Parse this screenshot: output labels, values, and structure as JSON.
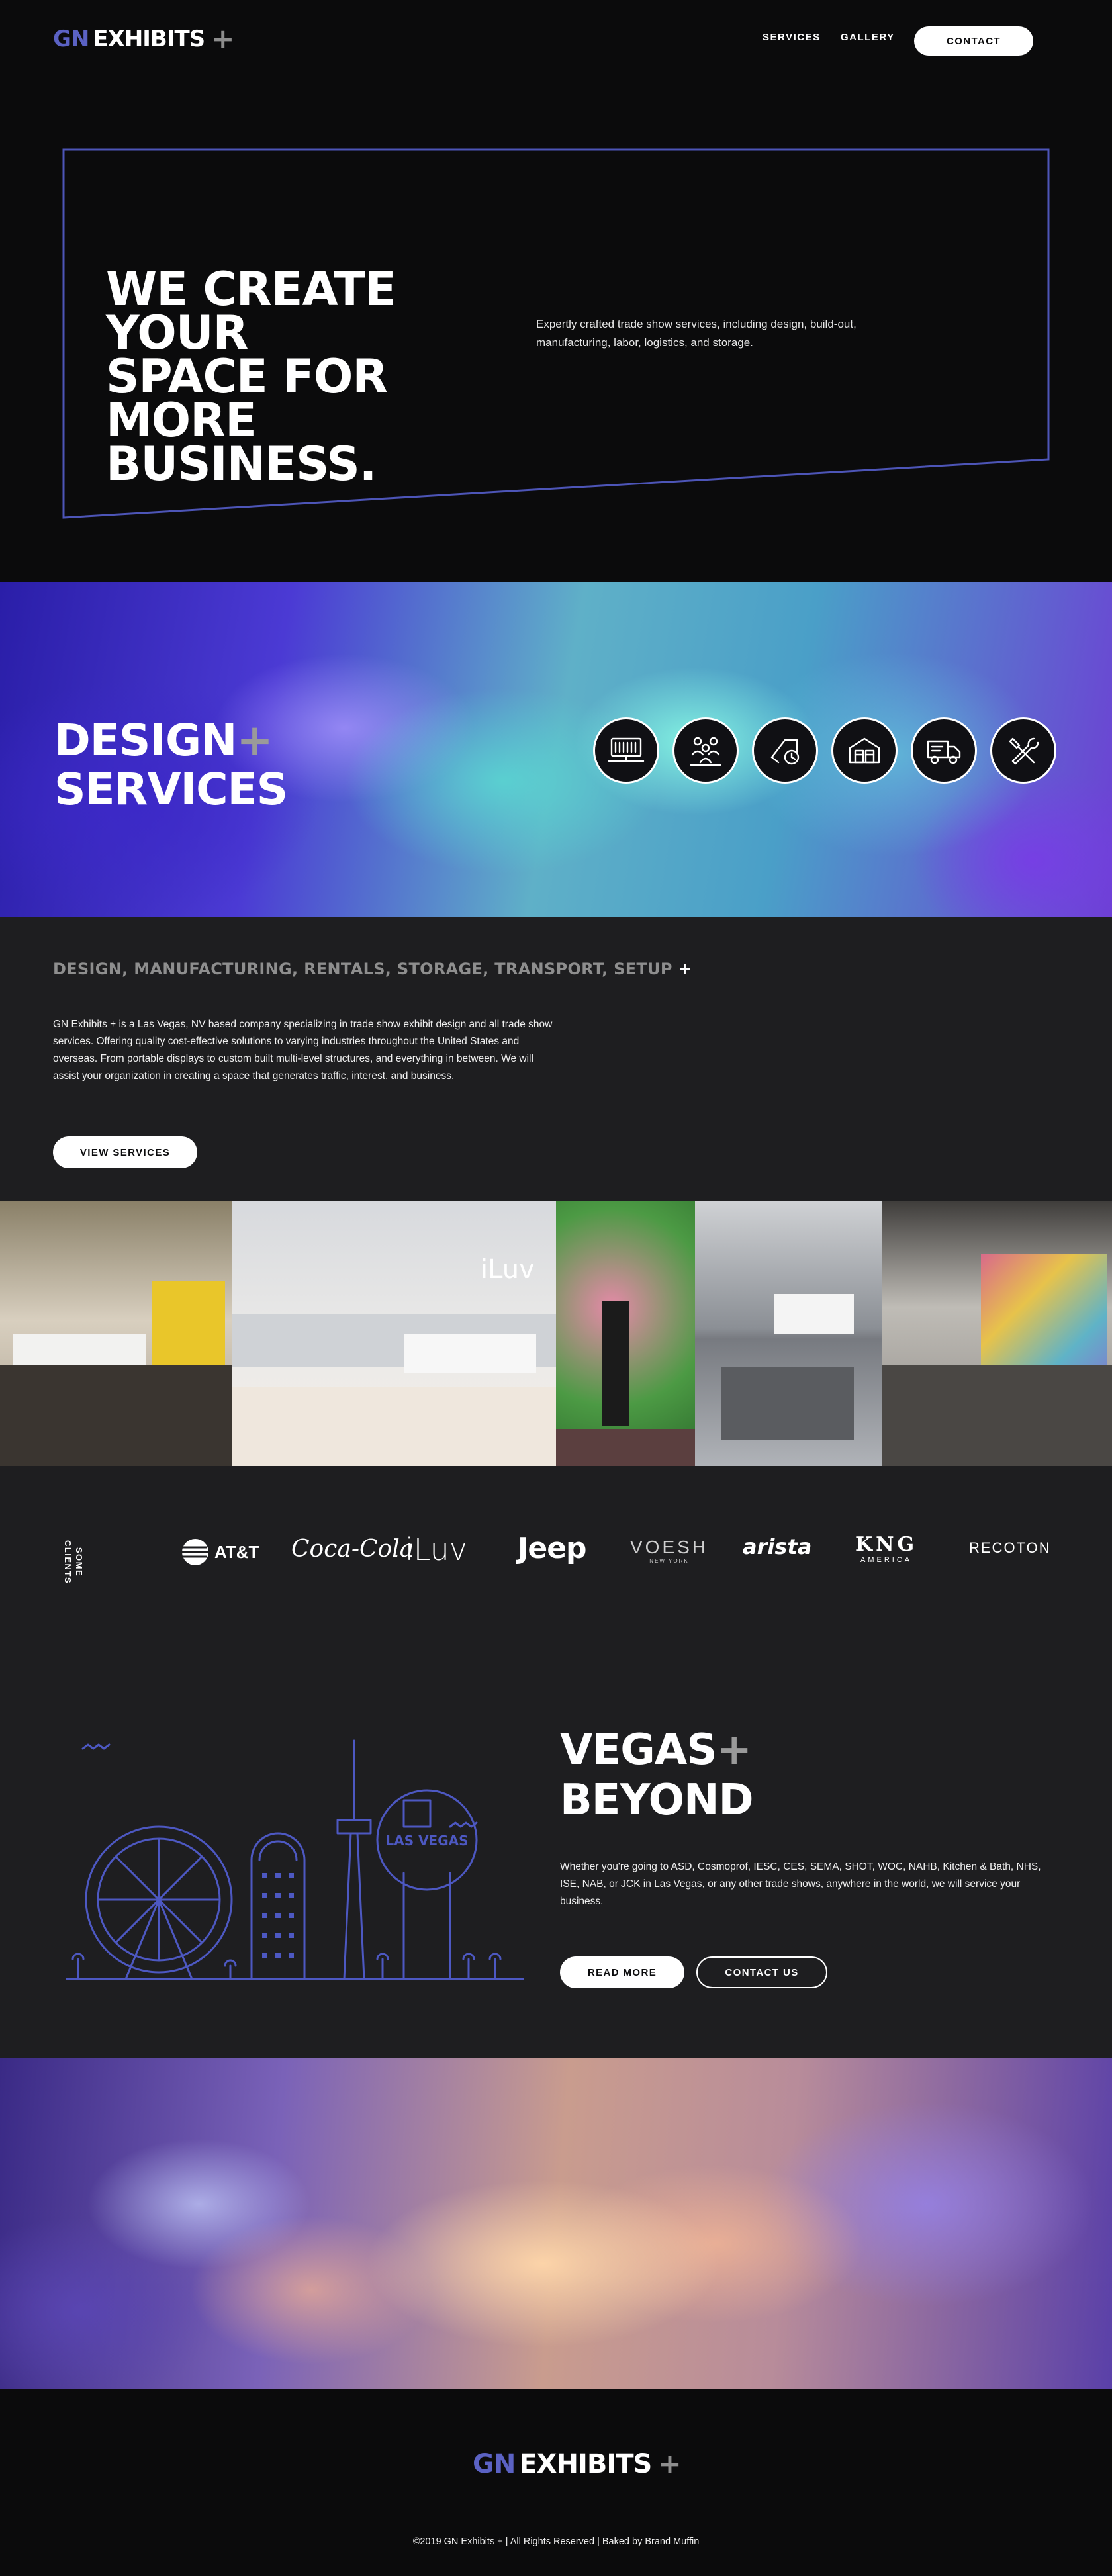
{
  "nav": {
    "logo": {
      "gn": "GN",
      "exhibits": "EXHIBITS",
      "plus": "+"
    },
    "links": [
      "SERVICES",
      "GALLERY"
    ],
    "contact_label": "CONTACT"
  },
  "hero": {
    "title_lines": [
      "WE CREATE YOUR",
      "SPACE FOR MORE",
      "BUSINESS."
    ],
    "subtitle": "Expertly crafted trade show services, including design, build-out, manufacturing, labor, logistics, and storage."
  },
  "design": {
    "title_line1": "DESIGN",
    "title_plus": "+",
    "title_line2": "SERVICES",
    "icons": [
      "display-booth-icon",
      "team-labor-icon",
      "design-clock-icon",
      "warehouse-storage-icon",
      "delivery-truck-icon",
      "tools-setup-icon"
    ]
  },
  "services": {
    "heading": "DESIGN, MANUFACTURING, RENTALS, STORAGE, TRANSPORT, SETUP",
    "heading_plus": "+",
    "body": "GN Exhibits + is a Las Vegas, NV based company specializing in trade show exhibit design and all trade show services. Offering quality cost-effective solutions to varying industries throughout the United States and overseas. From portable displays to custom built multi-level structures, and everything in between. We will assist your organization in creating a space that generates traffic, interest, and business.",
    "button_label": "VIEW SERVICES"
  },
  "gallery": {
    "photo_overlay_text": "iLuv"
  },
  "clients": {
    "label_line1": "SOME",
    "label_line2": "CLIENTS",
    "logos": [
      "AT&T",
      "Coca-Cola",
      "iLuv",
      "Jeep",
      "VOESH",
      "NEW YORK",
      "arista",
      "KNG",
      "AMERICA",
      "RECOTON"
    ]
  },
  "vegas": {
    "title_line1": "VEGAS",
    "title_plus": "+",
    "title_line2": "BEYOND",
    "illustration_sign": "LAS VEGAS",
    "body": "Whether you're going to ASD, Cosmoprof, IESC, CES, SEMA, SHOT, WOC, NAHB, Kitchen & Bath, NHS, ISE, NAB, or JCK in Las Vegas, or any other trade shows, anywhere in the world, we will service your business.",
    "read_more_label": "READ MORE",
    "contact_label": "CONTACT US"
  },
  "footer": {
    "logo": {
      "gn": "GN",
      "exhibits": "EXHIBITS",
      "plus": "+"
    },
    "copyright": "©2019 GN Exhibits + | All Rights Reserved | Baked by Brand Muffin"
  },
  "colors": {
    "background": "#0b0b0c",
    "section_gray": "#1e1e20",
    "accent_blue": "#5b62c4",
    "muted_gray": "#8e8e8e"
  }
}
